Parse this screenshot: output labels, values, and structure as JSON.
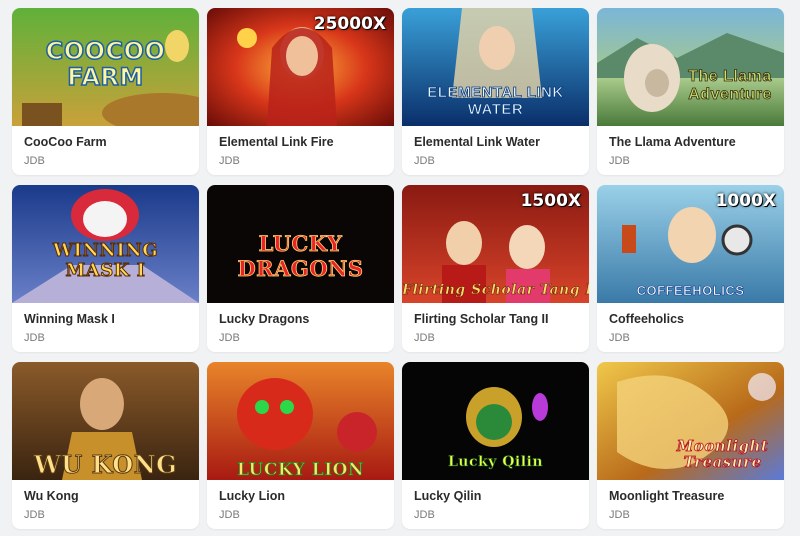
{
  "games": [
    {
      "name": "CooCoo Farm",
      "provider": "JDB",
      "art_title": "COOCOO FARM",
      "multiplier": ""
    },
    {
      "name": "Elemental Link Fire",
      "provider": "JDB",
      "art_title": "",
      "multiplier": "25000X"
    },
    {
      "name": "Elemental Link Water",
      "provider": "JDB",
      "art_title": "ELEMENTAL LINK WATER",
      "multiplier": ""
    },
    {
      "name": "The Llama Adventure",
      "provider": "JDB",
      "art_title": "The Llama Adventure",
      "multiplier": ""
    },
    {
      "name": "Winning Mask I",
      "provider": "JDB",
      "art_title": "WINNING MASK I",
      "multiplier": ""
    },
    {
      "name": "Lucky Dragons",
      "provider": "JDB",
      "art_title": "LUCKY DRAGONS",
      "multiplier": ""
    },
    {
      "name": "Flirting Scholar Tang II",
      "provider": "JDB",
      "art_title": "Flirting Scholar Tang II",
      "multiplier": "1500X"
    },
    {
      "name": "Coffeeholics",
      "provider": "JDB",
      "art_title": "COFFEEHOLICS",
      "multiplier": "1000X"
    },
    {
      "name": "Wu Kong",
      "provider": "JDB",
      "art_title": "WU KONG",
      "multiplier": ""
    },
    {
      "name": "Lucky Lion",
      "provider": "JDB",
      "art_title": "LUCKY LION",
      "multiplier": ""
    },
    {
      "name": "Lucky Qilin",
      "provider": "JDB",
      "art_title": "Lucky Qilin",
      "multiplier": ""
    },
    {
      "name": "Moonlight Treasure",
      "provider": "JDB",
      "art_title": "Moonlight Treasure",
      "multiplier": ""
    }
  ]
}
